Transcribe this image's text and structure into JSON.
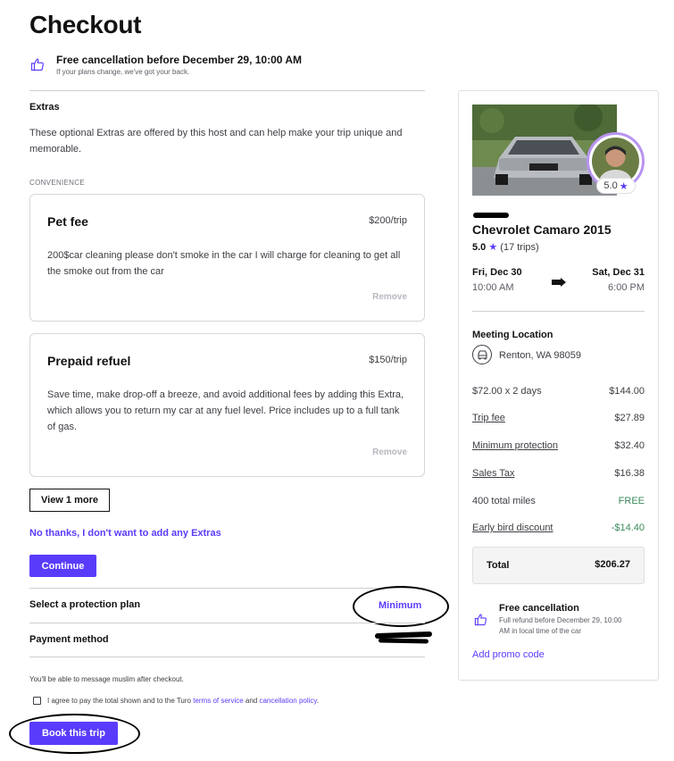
{
  "page": {
    "title": "Checkout"
  },
  "free_cancellation_banner": {
    "title": "Free cancellation before December 29, 10:00 AM",
    "subtitle": "If your plans change, we've got your back."
  },
  "extras": {
    "heading": "Extras",
    "description": "These optional Extras are offered by this host and can help make your trip unique and memorable.",
    "category": "CONVENIENCE",
    "items": [
      {
        "name": "Pet fee",
        "price": "$200/trip",
        "description": "200$car cleaning please don't smoke in the car I will charge for cleaning to get all the smoke out from the car",
        "remove_label": "Remove"
      },
      {
        "name": "Prepaid refuel",
        "price": "$150/trip",
        "description": "Save time, make drop-off a breeze, and avoid additional fees by adding this Extra, which allows you to return my car at any fuel level. Price includes up to a full tank of gas.",
        "remove_label": "Remove"
      }
    ],
    "view_more_label": "View 1 more",
    "decline_label": "No thanks, I don't want to add any Extras",
    "continue_label": "Continue"
  },
  "protection": {
    "label": "Select a protection plan",
    "value": "Minimum"
  },
  "payment": {
    "label": "Payment method"
  },
  "message_note": "You'll be able to message muslim after checkout.",
  "agreement": {
    "text_before": "I agree to pay the total shown and to the Turo ",
    "terms_link": "terms of service",
    "text_middle": " and ",
    "policy_link": "cancellation policy",
    "text_after": ".",
    "checked": false
  },
  "book_label": "Book this trip",
  "sidebar": {
    "host_rating": "5.0",
    "car_name": "Chevrolet Camaro 2015",
    "rating": "5.0",
    "trips": "(17 trips)",
    "start_day": "Fri, Dec 30",
    "start_time": "10:00 AM",
    "end_day": "Sat, Dec 31",
    "end_time": "6:00 PM",
    "meeting_heading": "Meeting Location",
    "meeting_location": "Renton, WA 98059",
    "price_rows": [
      {
        "label": "$72.00 x 2 days",
        "value": "$144.00",
        "link": false
      },
      {
        "label": "Trip fee",
        "value": "$27.89",
        "link": true
      },
      {
        "label": "Minimum protection",
        "value": "$32.40",
        "link": true
      },
      {
        "label": "Sales Tax",
        "value": "$16.38",
        "link": true
      },
      {
        "label": "400 total miles",
        "value": "FREE",
        "link": false
      },
      {
        "label": "Early bird discount",
        "value": "-$14.40",
        "link": true
      }
    ],
    "total_label": "Total",
    "total_value": "$206.27",
    "free_cancel_title": "Free cancellation",
    "free_cancel_sub": "Full refund before December 29, 10:00 AM in local time of the car",
    "promo_label": "Add promo code"
  },
  "colors": {
    "accent": "#593cfb",
    "discount": "#3a8a5a",
    "free": "#3a8a5a"
  },
  "icons": [
    "thumbs-up-icon",
    "star-icon",
    "arrow-right-icon",
    "car-icon"
  ]
}
